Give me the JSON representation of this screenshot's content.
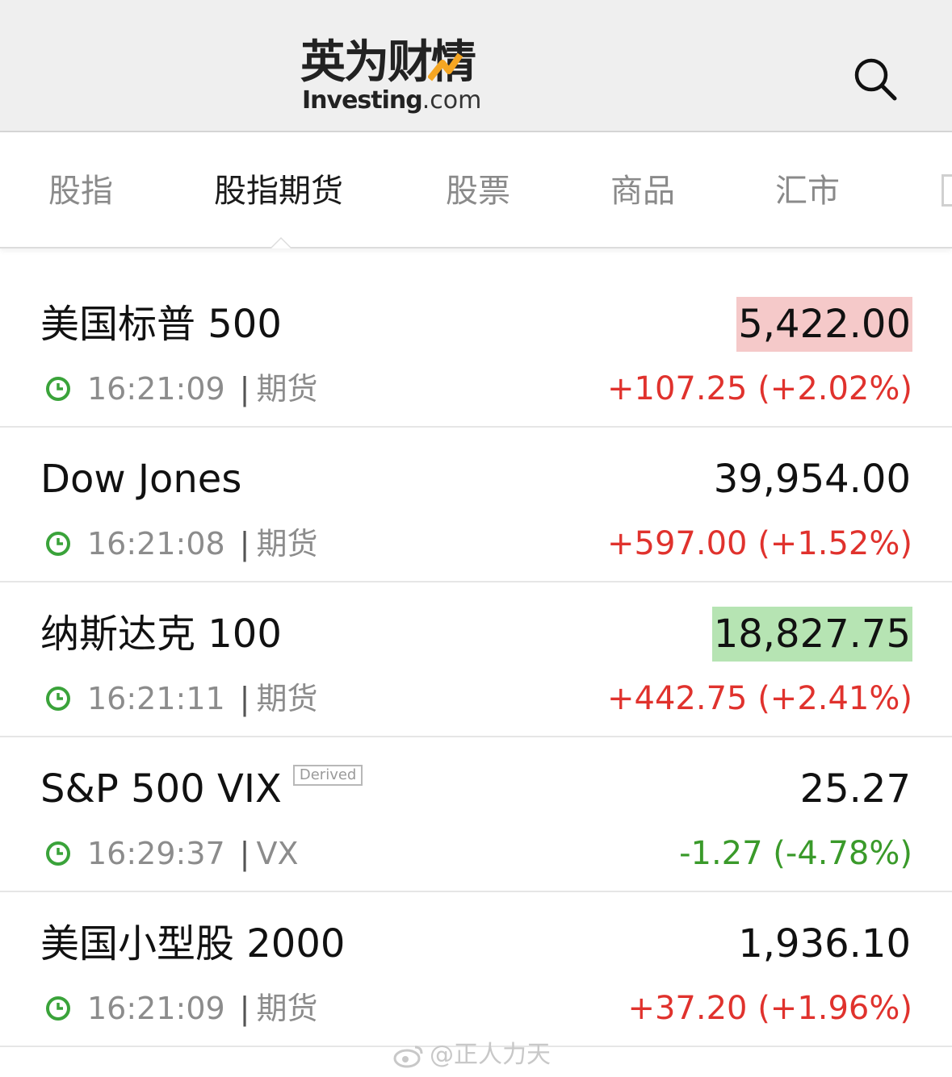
{
  "header": {
    "logo_cn": "英为财情",
    "logo_en": "Investing",
    "logo_domain": ".com",
    "accent_color": "#f5a623"
  },
  "tabs": [
    {
      "label": "股指",
      "active": false
    },
    {
      "label": "股指期货",
      "active": true
    },
    {
      "label": "股票",
      "active": false
    },
    {
      "label": "商品",
      "active": false
    },
    {
      "label": "汇市",
      "active": false
    }
  ],
  "rows": [
    {
      "name": "美国标普 500",
      "time": "16:21:09",
      "sep": "|",
      "type": "期货",
      "price": "5,422.00",
      "change": "+107.25 (+2.02%)",
      "direction": "up",
      "flash": "red",
      "badge": ""
    },
    {
      "name": "Dow Jones",
      "time": "16:21:08",
      "sep": "|",
      "type": "期货",
      "price": "39,954.00",
      "change": "+597.00 (+1.52%)",
      "direction": "up",
      "flash": "",
      "badge": ""
    },
    {
      "name": "纳斯达克 100",
      "time": "16:21:11",
      "sep": "|",
      "type": "期货",
      "price": "18,827.75",
      "change": "+442.75 (+2.41%)",
      "direction": "up",
      "flash": "green",
      "badge": ""
    },
    {
      "name": "S&P 500 VIX",
      "time": "16:29:37",
      "sep": "|",
      "type": "VX",
      "price": "25.27",
      "change": "-1.27 (-4.78%)",
      "direction": "down",
      "flash": "",
      "badge": "Derived"
    },
    {
      "name": "美国小型股 2000",
      "time": "16:21:09",
      "sep": "|",
      "type": "期货",
      "price": "1,936.10",
      "change": "+37.20 (+1.96%)",
      "direction": "up",
      "flash": "",
      "badge": ""
    }
  ],
  "colors": {
    "positive": "#e0322d",
    "negative": "#3a9a2a",
    "clock": "#3aa33a",
    "flash_red": "#f5c9c9",
    "flash_green": "#b6e4b3"
  },
  "watermark": "@正人力天"
}
